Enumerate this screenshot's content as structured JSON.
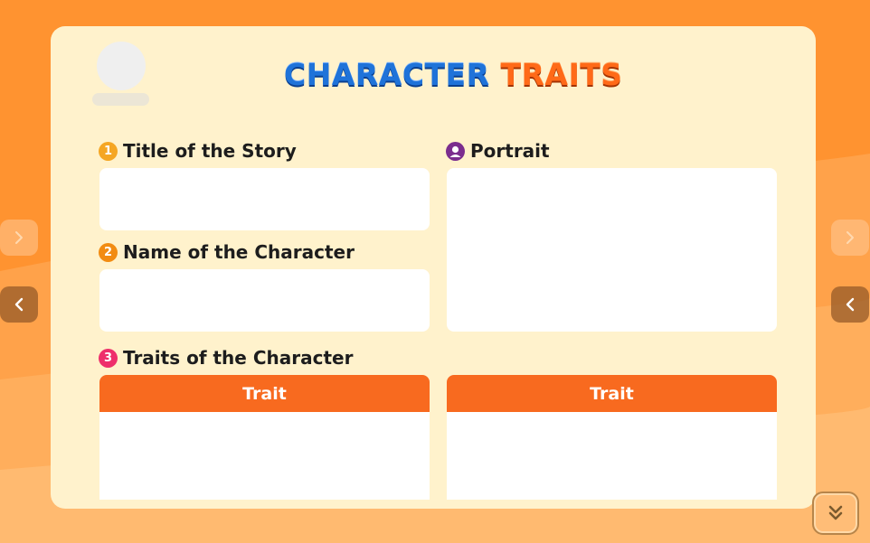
{
  "header": {
    "title_word1": "CHARACTER",
    "title_word2": "TRAITS"
  },
  "sections": {
    "story_title": {
      "number": "1",
      "label": "Title of the Story",
      "badge_color": "#f5a623"
    },
    "character_name": {
      "number": "2",
      "label": "Name of the Character",
      "badge_color": "#f28c12"
    },
    "portrait": {
      "label": "Portrait",
      "icon": "user-circle-icon",
      "badge_color": "#7b2d8e"
    },
    "traits": {
      "number": "3",
      "label": "Traits of the Character",
      "badge_color": "#ee2f6b"
    }
  },
  "trait_columns": [
    {
      "header": "Trait"
    },
    {
      "header": "Trait"
    }
  ],
  "navigation": {
    "left_next_icon": "chevron-right-icon",
    "left_prev_icon": "chevron-left-icon",
    "right_next_icon": "chevron-right-icon",
    "right_prev_icon": "chevron-left-icon",
    "scroll_icon": "double-chevron-down-icon"
  },
  "colors": {
    "background": "#ff9a3a",
    "card": "#fff2cc",
    "accent_orange": "#f86a1f",
    "title_blue": "#1f73d9",
    "title_orange": "#ff6a18"
  }
}
